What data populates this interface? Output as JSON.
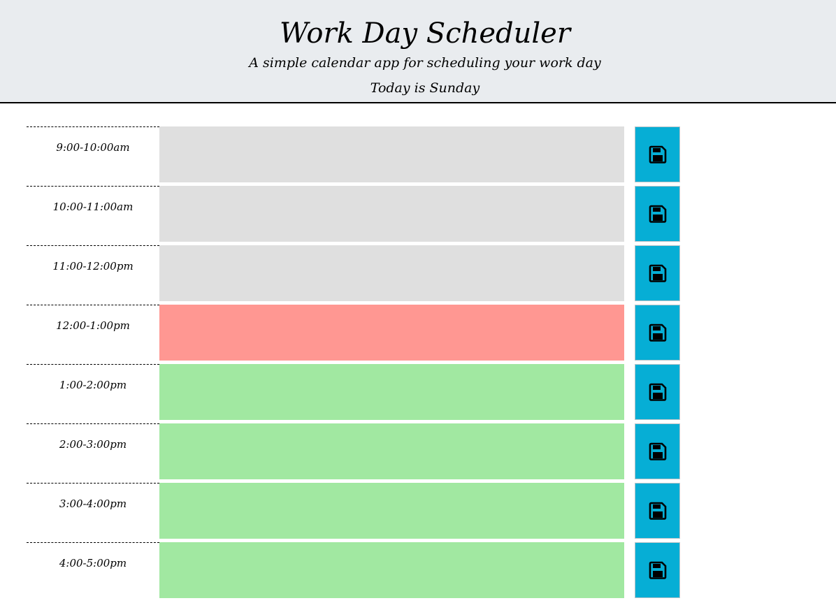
{
  "header": {
    "title": "Work Day Scheduler",
    "subtitle": "A simple calendar app for scheduling your work day",
    "today": "Today is Sunday"
  },
  "colors": {
    "past": "#dfdfdf",
    "present": "#ff9792",
    "future": "#a1e8a1",
    "save_button": "#06aed5"
  },
  "rows": [
    {
      "hour": "9:00-10:00am",
      "status": "past",
      "text": ""
    },
    {
      "hour": "10:00-11:00am",
      "status": "past",
      "text": ""
    },
    {
      "hour": "11:00-12:00pm",
      "status": "past",
      "text": ""
    },
    {
      "hour": "12:00-1:00pm",
      "status": "present",
      "text": ""
    },
    {
      "hour": "1:00-2:00pm",
      "status": "future",
      "text": ""
    },
    {
      "hour": "2:00-3:00pm",
      "status": "future",
      "text": ""
    },
    {
      "hour": "3:00-4:00pm",
      "status": "future",
      "text": ""
    },
    {
      "hour": "4:00-5:00pm",
      "status": "future",
      "text": ""
    }
  ],
  "icons": {
    "save": "floppy-disk-icon"
  }
}
